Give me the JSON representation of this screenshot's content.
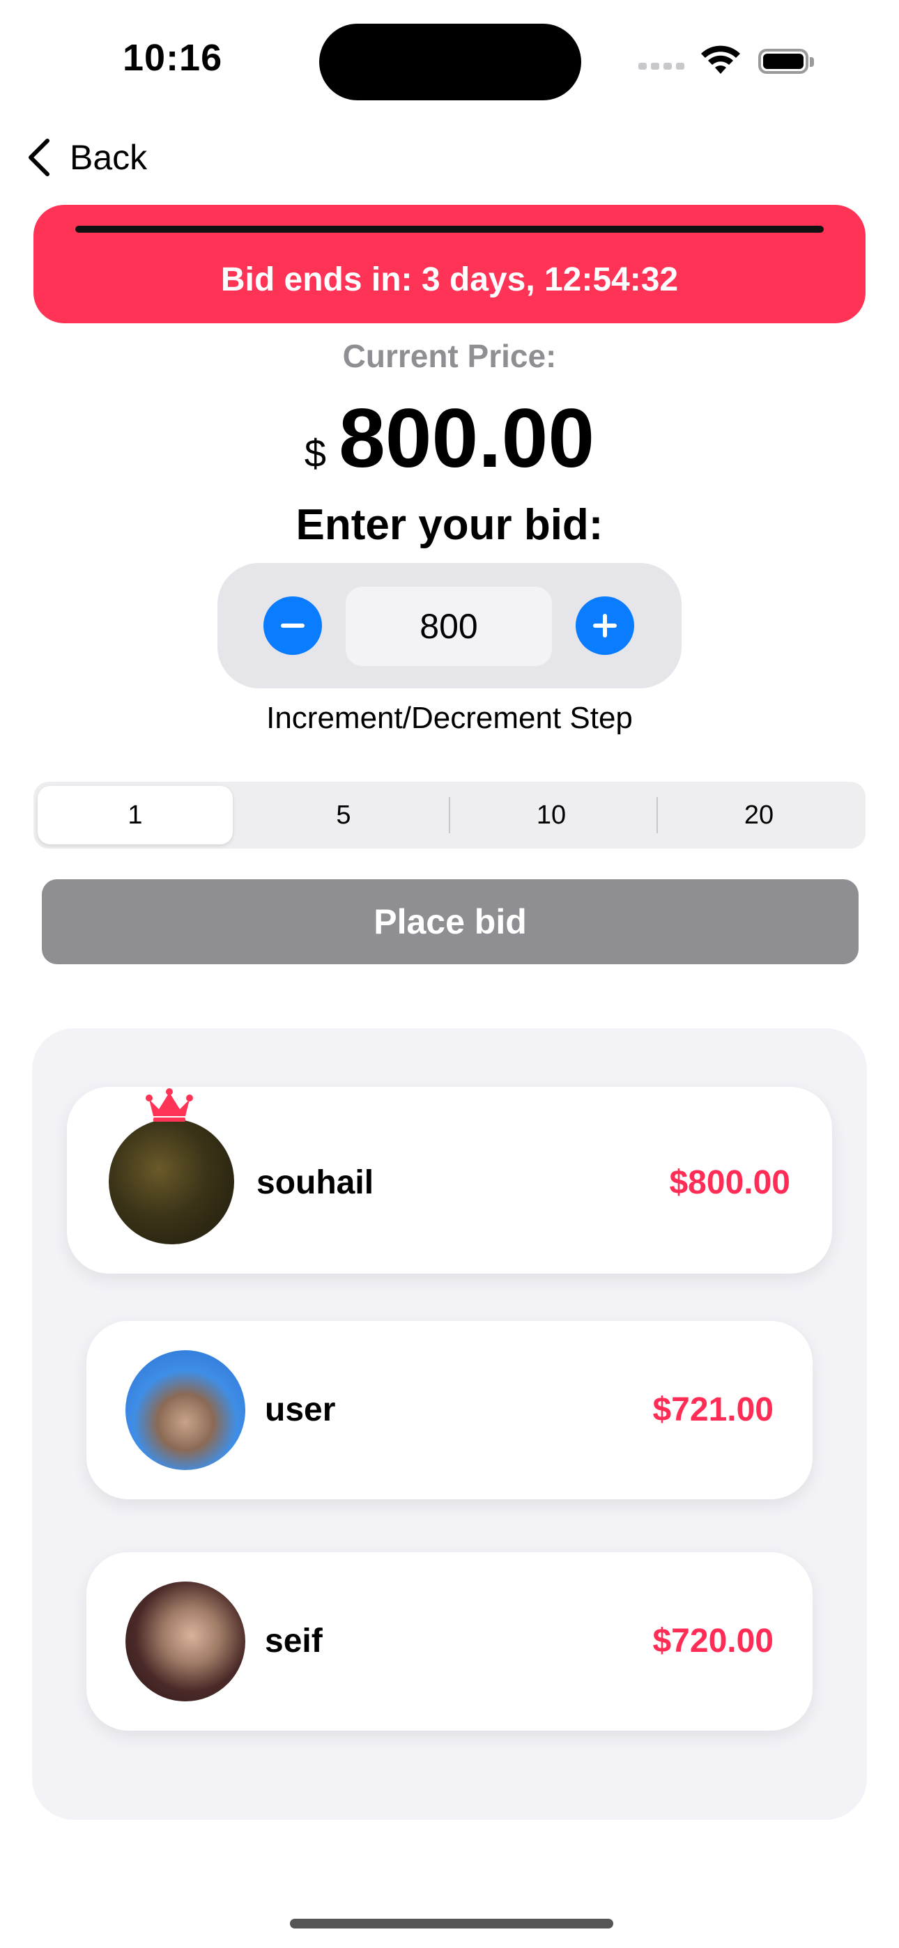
{
  "status_bar": {
    "time": "10:16"
  },
  "nav": {
    "back_label": "Back"
  },
  "countdown": {
    "text": "Bid ends in: 3 days, 12:54:32",
    "color": "#ff3355"
  },
  "price": {
    "label": "Current Price:",
    "currency": "$",
    "value": "800.00"
  },
  "bid": {
    "label": "Enter your bid:",
    "value": "800",
    "step_label": "Increment/Decrement Step",
    "steps": [
      "1",
      "5",
      "10",
      "20"
    ],
    "selected_step": "1",
    "place_bid_label": "Place bid",
    "accent_color": "#0a7cff"
  },
  "bidders": [
    {
      "name": "souhail",
      "amount": "$800.00",
      "leader": true,
      "icon": "crown-icon"
    },
    {
      "name": "user",
      "amount": "$721.00",
      "leader": false
    },
    {
      "name": "seif",
      "amount": "$720.00",
      "leader": false
    }
  ],
  "colors": {
    "amount": "#ff2d55",
    "place_bid_disabled": "#8e8e93"
  }
}
